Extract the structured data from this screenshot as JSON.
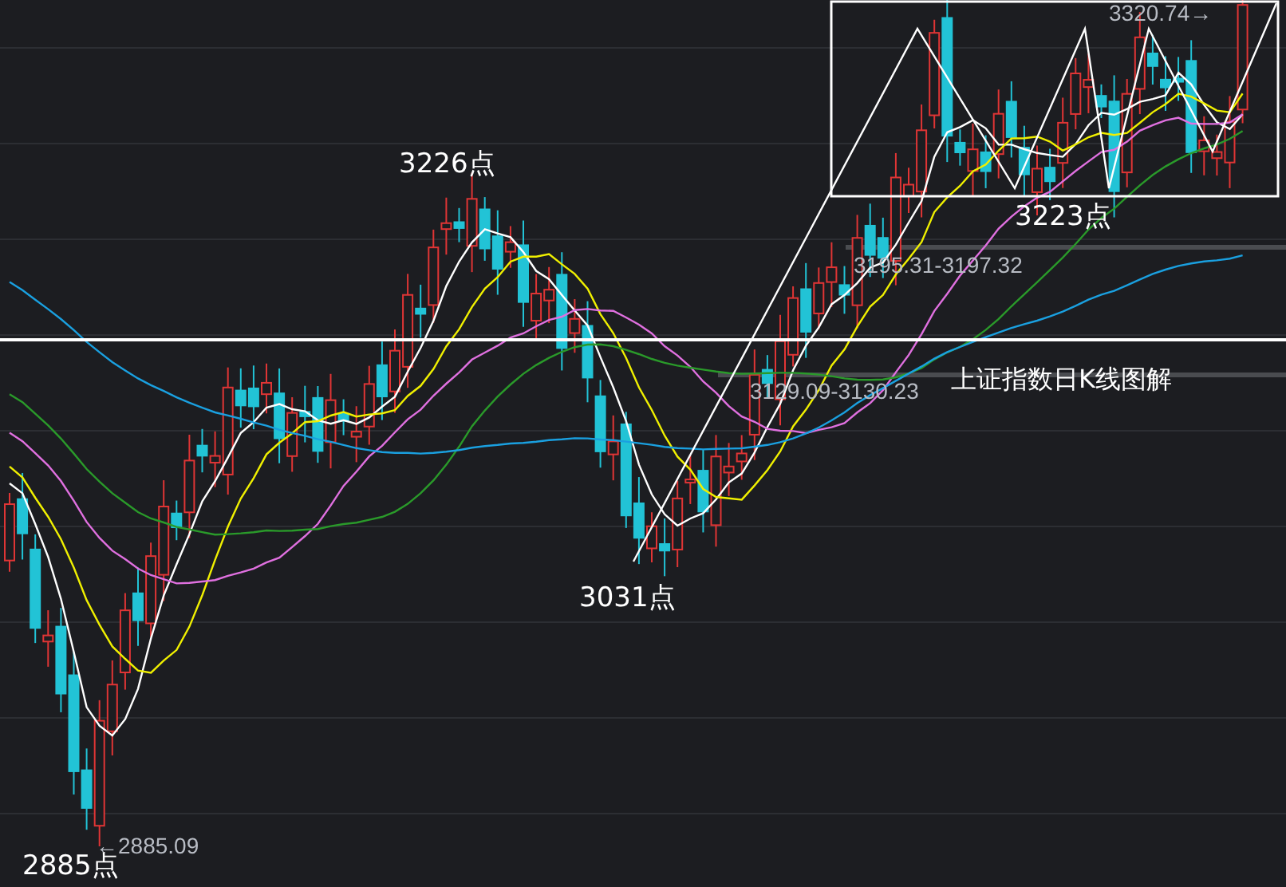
{
  "chart_picture": {
    "title": "上证指数日K线图解",
    "labels": [
      {
        "text": "3226点",
        "kind": "point"
      },
      {
        "text": "3031点",
        "kind": "point"
      },
      {
        "text": "3223点",
        "kind": "point"
      },
      {
        "text": "2885点",
        "kind": "point"
      },
      {
        "text": "←2885.09",
        "kind": "price"
      },
      {
        "text": "3195.31-3197.32",
        "kind": "price"
      },
      {
        "text": "3129.09-3130.23",
        "kind": "price"
      },
      {
        "text": "3320.74→",
        "kind": "price"
      }
    ]
  }
}
